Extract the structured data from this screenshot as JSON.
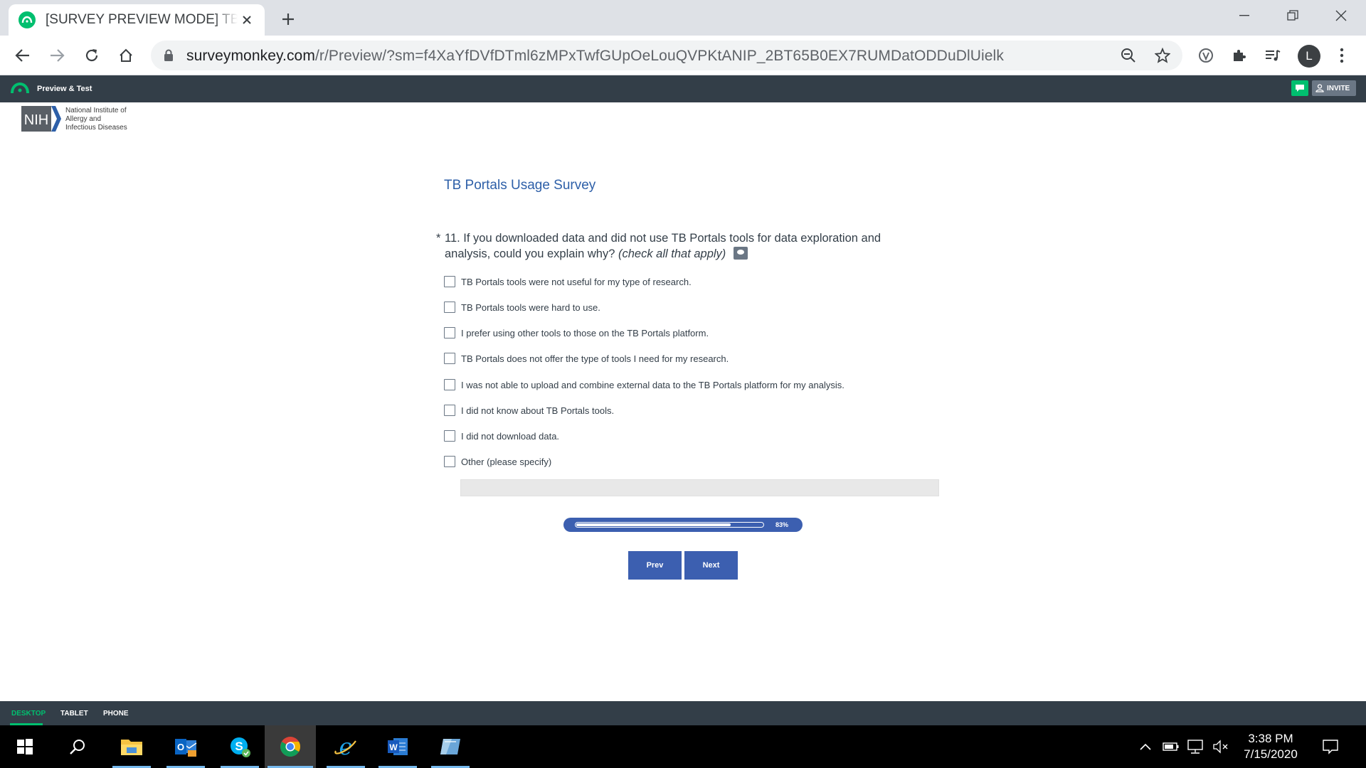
{
  "browser": {
    "tab_title": "[SURVEY PREVIEW MODE] TB Portals Usage Survey",
    "url_host": "surveymonkey.com",
    "url_path": "/r/Preview/?sm=f4XaYfDVfDTml6zMPxTwfGUpOeLouQVPKtANIP_2BT65B0EX7RUMDatODDuDlUielk",
    "profile_initial": "L"
  },
  "preview_bar": {
    "label": "Preview & Test",
    "invite_label": "INVITE"
  },
  "logo": {
    "badge_text": "NIH",
    "line1": "National Institute of",
    "line2": "Allergy and",
    "line3": "Infectious Diseases"
  },
  "survey": {
    "title": "TB Portals Usage Survey",
    "required_mark": "*",
    "question_text": "11. If you downloaded data and did not use TB Portals tools for data exploration and analysis, could you explain why?",
    "question_hint": "(check all that apply)",
    "options": [
      "TB Portals tools were not useful for my type of research.",
      "TB Portals tools were hard to use.",
      "I prefer using other tools to those on the TB Portals platform.",
      "TB Portals does not offer the type of tools I need for my research.",
      "I was not able to upload and combine external data to the TB Portals platform for my analysis.",
      "I did not know about TB Portals tools.",
      "I did not download data.",
      "Other (please specify)"
    ],
    "other_value": "",
    "progress_percent": 83,
    "progress_label": "83%",
    "prev_label": "Prev",
    "next_label": "Next"
  },
  "device_bar": {
    "tabs": [
      "DESKTOP",
      "TABLET",
      "PHONE"
    ],
    "active": "DESKTOP"
  },
  "taskbar": {
    "time": "3:38 PM",
    "date": "7/15/2020"
  },
  "colors": {
    "accent_green": "#00bf6f",
    "survey_blue": "#3c5fb0",
    "title_blue": "#2d5fa8",
    "dark_bar": "#333e48"
  }
}
